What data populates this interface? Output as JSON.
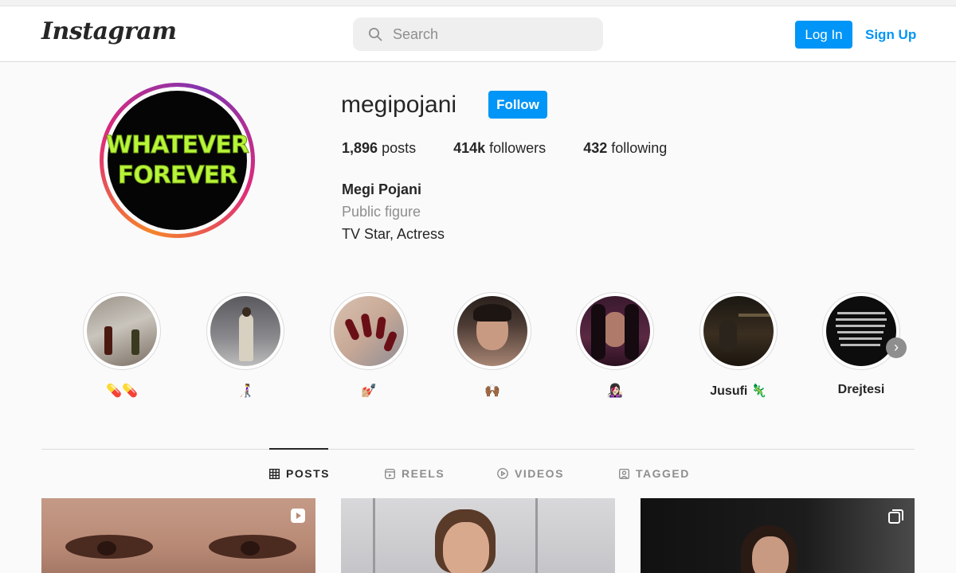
{
  "header": {
    "logo": "Instagram",
    "search_placeholder": "Search",
    "login_label": "Log In",
    "signup_label": "Sign Up"
  },
  "profile": {
    "avatar_text_line1": "WHATEVER",
    "avatar_text_line2": "FOREVER",
    "username": "megipojani",
    "follow_label": "Follow",
    "stats": {
      "posts_count": "1,896",
      "posts_label": "posts",
      "followers_count": "414k",
      "followers_label": "followers",
      "following_count": "432",
      "following_label": "following"
    },
    "full_name": "Megi Pojani",
    "category": "Public figure",
    "bio": "TV Star, Actress"
  },
  "highlights": [
    {
      "label": "💊💊"
    },
    {
      "label": "👩‍🦯"
    },
    {
      "label": "💅🏼"
    },
    {
      "label": "🙌🏾"
    },
    {
      "label": "👩🏻‍🎤"
    },
    {
      "label": "Jusufi 🦎"
    },
    {
      "label": "Drejtesi"
    }
  ],
  "tabs": [
    {
      "label": "POSTS",
      "icon": "grid-icon"
    },
    {
      "label": "REELS",
      "icon": "reels-icon"
    },
    {
      "label": "VIDEOS",
      "icon": "video-icon"
    },
    {
      "label": "TAGGED",
      "icon": "tagged-icon"
    }
  ],
  "colors": {
    "accent": "#0095f6",
    "background": "#fafafa",
    "text": "#262626",
    "muted": "#8e8e8e"
  }
}
